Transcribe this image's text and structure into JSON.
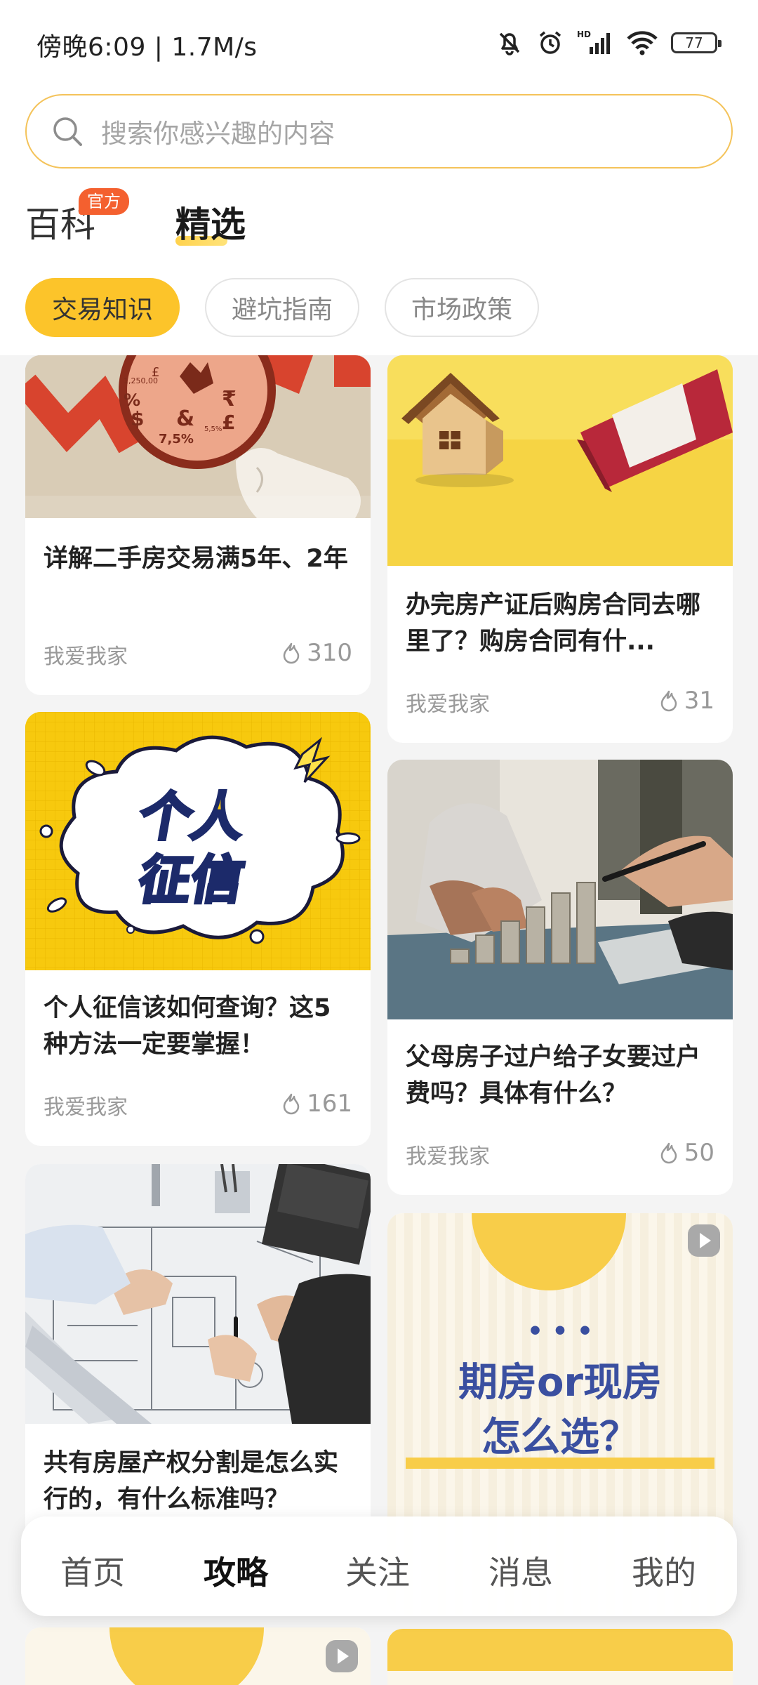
{
  "status_bar": {
    "time_speed": "傍晚6:09 | 1.7M/s",
    "battery": "77"
  },
  "search": {
    "placeholder": "搜索你感兴趣的内容"
  },
  "tabs": [
    {
      "label": "百科",
      "badge": "官方"
    },
    {
      "label": "精选"
    }
  ],
  "chips": [
    "交易知识",
    "避坑指南",
    "市场政策"
  ],
  "cards": [
    {
      "title": "详解二手房交易满5年、2年",
      "author": "我爱我家",
      "likes": "310",
      "image_text": [
        "1,250,00",
        "%",
        "£",
        "₹",
        "$",
        "&",
        "7,5%",
        "5,5%"
      ]
    },
    {
      "title": "办完房产证后购房合同去哪里了？购房合同有什...",
      "author": "我爱我家",
      "likes": "31"
    },
    {
      "title": "个人征信该如何查询？这5种方法一定要掌握！",
      "author": "我爱我家",
      "likes": "161",
      "image_text": [
        "个人",
        "征信"
      ]
    },
    {
      "title": "父母房子过户给子女要过户费吗？具体有什么？",
      "author": "我爱我家",
      "likes": "50"
    },
    {
      "title": "共有房屋产权分割是怎么实行的，有什么标准吗？"
    },
    {
      "image_text": [
        "• • •",
        "期房or现房",
        "怎么选？"
      ]
    }
  ],
  "bottom_nav": [
    "首页",
    "攻略",
    "关注",
    "消息",
    "我的"
  ],
  "colors": {
    "accent": "#fcc42a",
    "badge": "#f4602f",
    "search_border": "#f4c35a",
    "promo_text": "#3a4fa0"
  }
}
